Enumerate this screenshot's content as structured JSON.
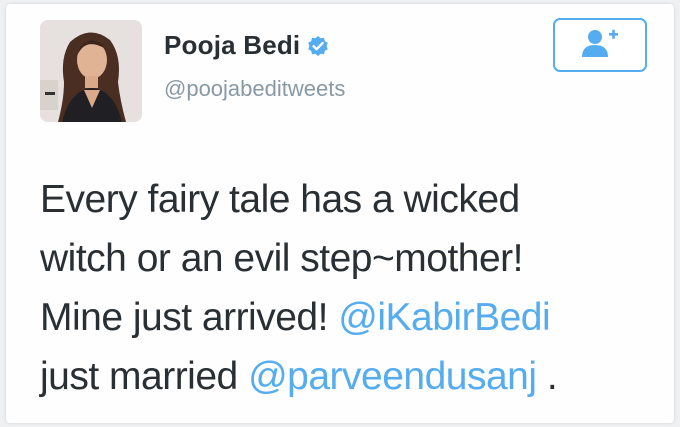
{
  "user": {
    "display_name": "Pooja Bedi",
    "handle": "@poojabeditweets",
    "verified": true
  },
  "colors": {
    "link": "#55acee",
    "text": "#292f33",
    "secondary": "#8899a6",
    "verified_badge": "#55acee"
  },
  "icons": {
    "verified": "verified-badge-icon",
    "follow": "follow-person-plus-icon"
  },
  "tweet": {
    "line1": "Every fairy tale has a wicked",
    "line2": "witch or an evil step~mother!",
    "line3_text": "Mine just arrived! ",
    "mention1": "@iKabirBedi",
    "line4_text": "just married ",
    "mention2": "@parveendusanj",
    "line4_end": " ."
  }
}
